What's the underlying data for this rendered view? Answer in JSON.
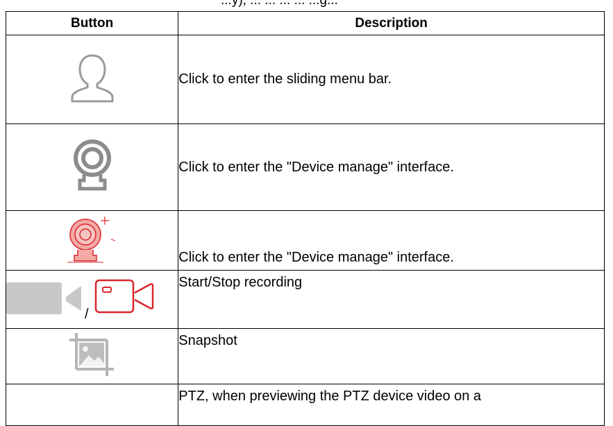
{
  "top_cut_text": "...y), ... ... ... ... ...g...",
  "table": {
    "headers": {
      "button": "Button",
      "description": "Description"
    },
    "rows": [
      {
        "icon": "user-silhouette-icon",
        "description": "Click to enter the sliding menu bar."
      },
      {
        "icon": "webcam-gray-icon",
        "description": "Click to enter the \"Device manage\" interface."
      },
      {
        "icon": "webcam-red-add-icon",
        "description": "Click to enter the \"Device manage\" interface."
      },
      {
        "icon": "record-toggle-icons",
        "separator": "/",
        "description": "Start/Stop recording"
      },
      {
        "icon": "snapshot-icon",
        "description": "Snapshot"
      },
      {
        "icon": "ptz-icon",
        "description": "PTZ, when previewing the PTZ device video on a"
      }
    ]
  },
  "colors": {
    "icon_gray": "#9a9a9a",
    "icon_red": "#d9252b",
    "icon_red_light": "#f4a9a4"
  }
}
